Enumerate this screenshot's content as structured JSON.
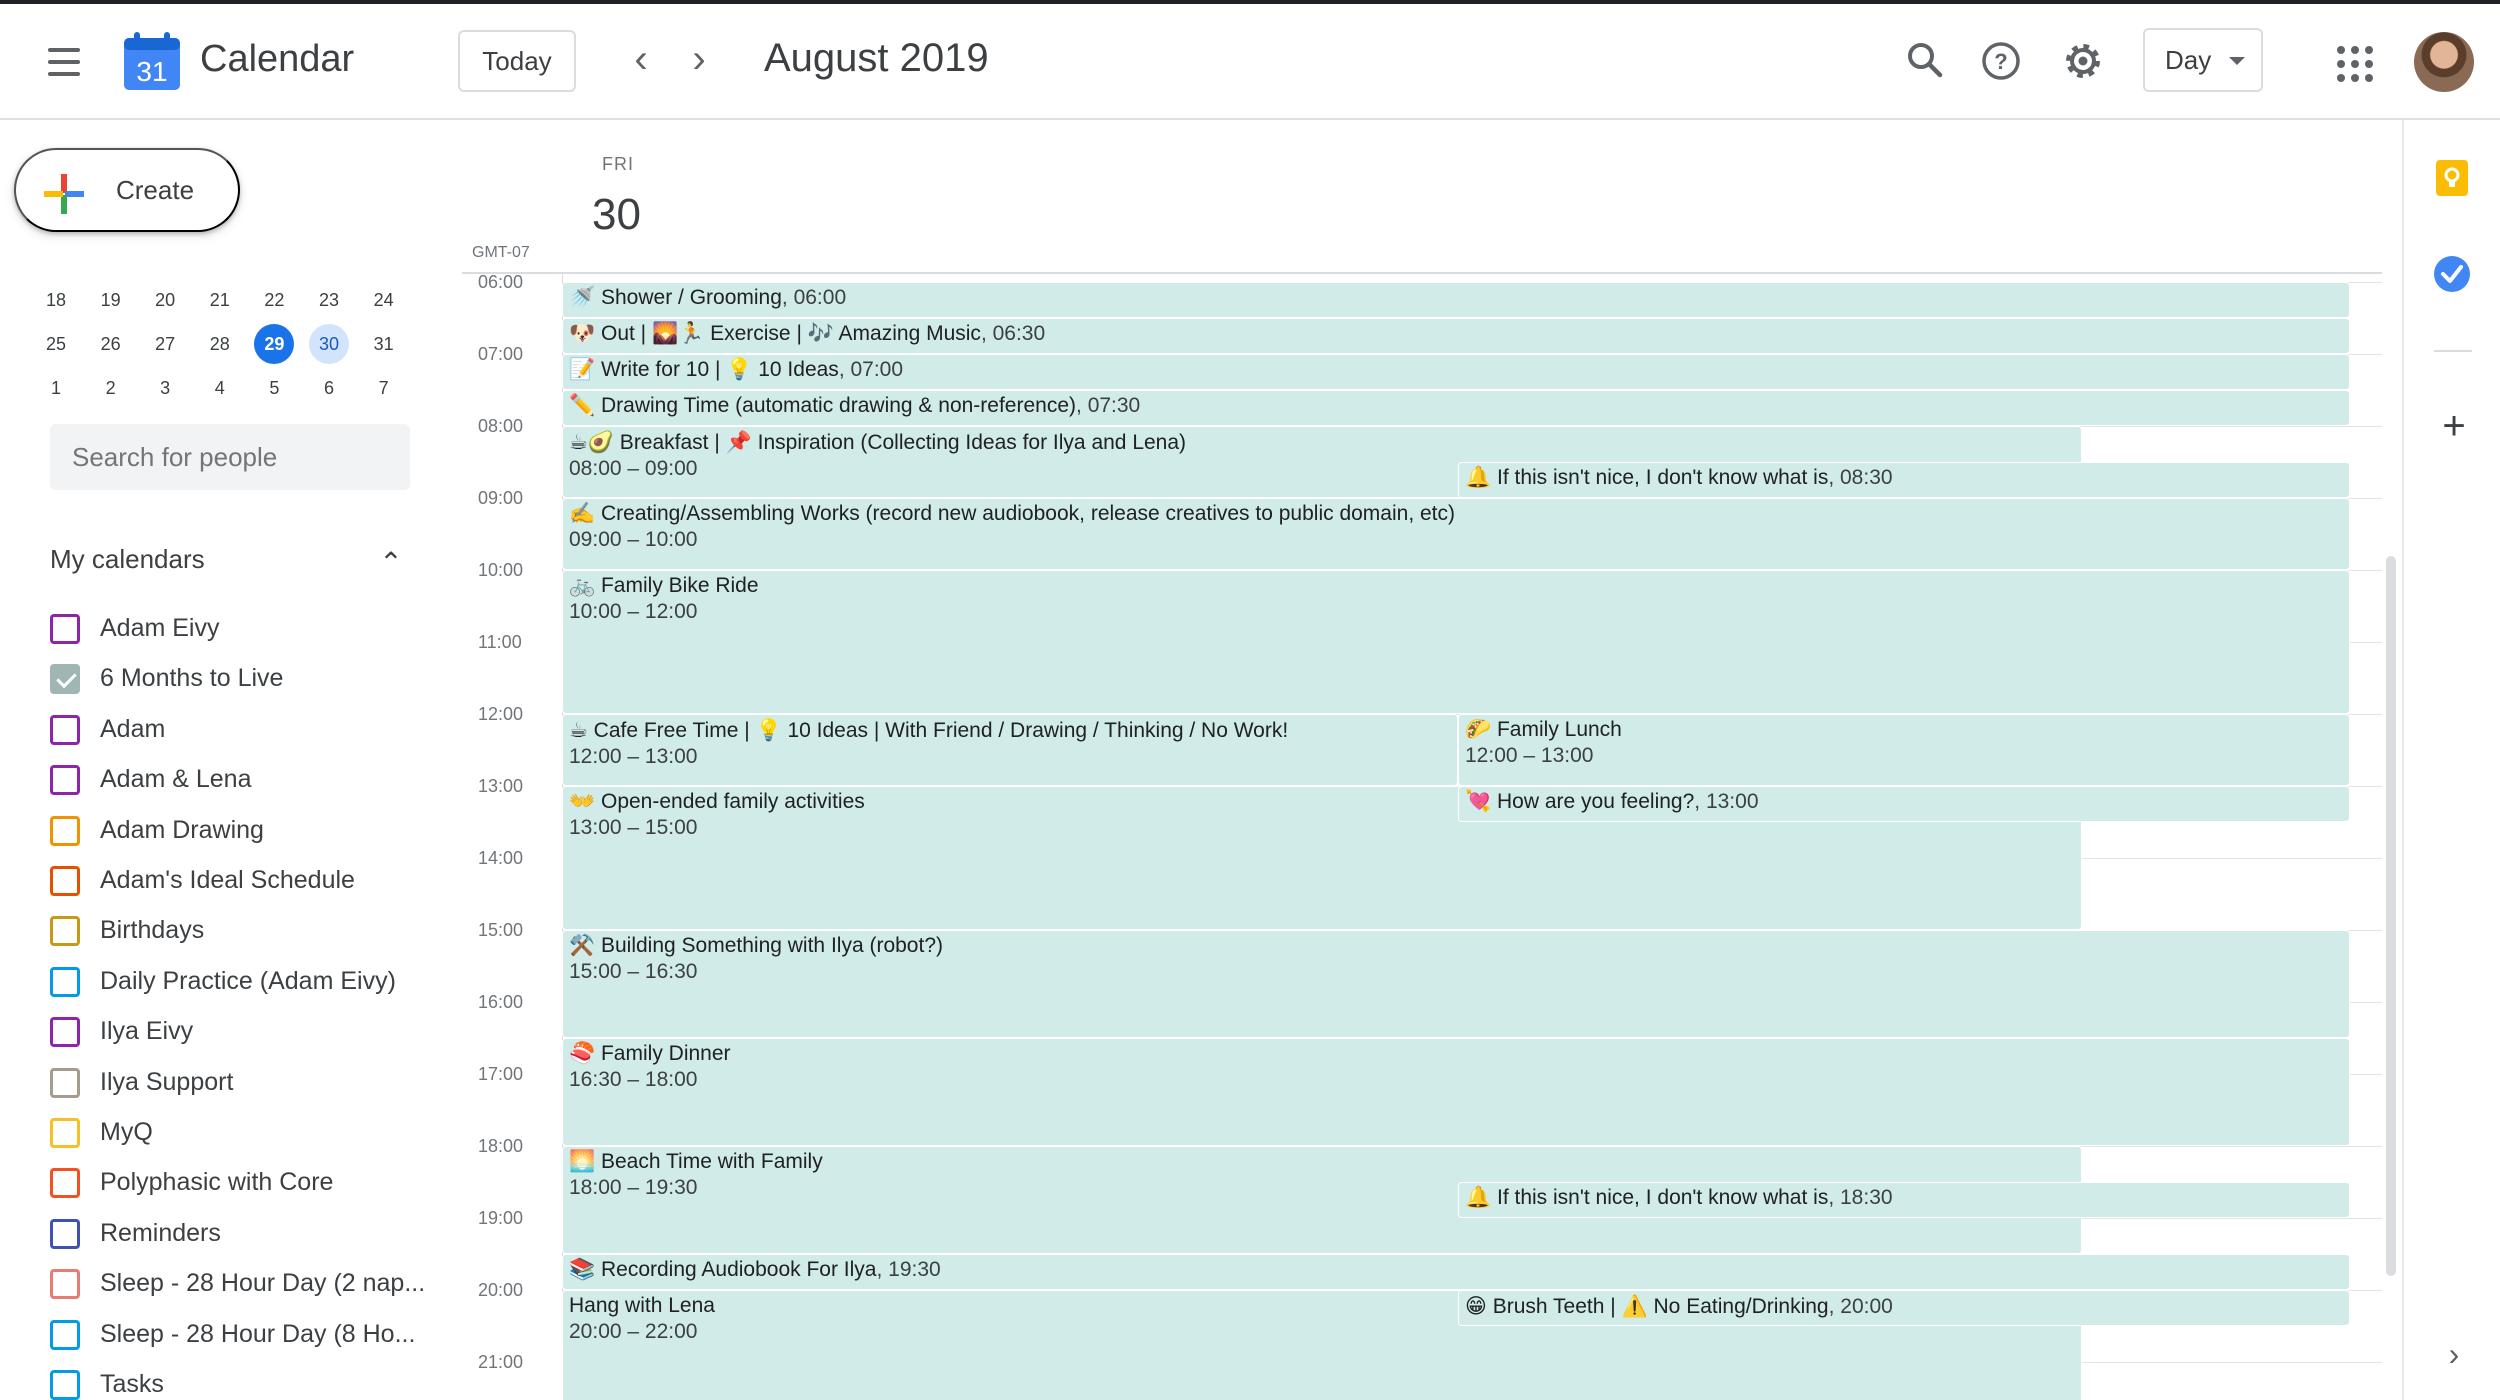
{
  "header": {
    "app_title": "Calendar",
    "logo_day": "31",
    "today_label": "Today",
    "prev_icon": "chevron-left-icon",
    "next_icon": "chevron-right-icon",
    "month_title": "August 2019",
    "view_label": "Day",
    "icons": [
      "search-icon",
      "help-icon",
      "settings-icon",
      "apps-grid-icon"
    ]
  },
  "sidebar": {
    "create_label": "Create",
    "mini_calendar": {
      "rows": [
        [
          "18",
          "19",
          "20",
          "21",
          "22",
          "23",
          "24"
        ],
        [
          "25",
          "26",
          "27",
          "28",
          "29",
          "30",
          "31"
        ],
        [
          "1",
          "2",
          "3",
          "4",
          "5",
          "6",
          "7"
        ]
      ],
      "today": "29",
      "selected": "30"
    },
    "search_people_placeholder": "Search for people",
    "my_calendars_label": "My calendars",
    "calendars": [
      {
        "name": "Adam Eivy",
        "color": "#8e24aa",
        "checked": false
      },
      {
        "name": "6 Months to Live",
        "color": "#9fb6b4",
        "checked": true
      },
      {
        "name": "Adam",
        "color": "#8e24aa",
        "checked": false
      },
      {
        "name": "Adam & Lena",
        "color": "#8e24aa",
        "checked": false
      },
      {
        "name": "Adam Drawing",
        "color": "#f09300",
        "checked": false
      },
      {
        "name": "Adam's Ideal Schedule",
        "color": "#e65100",
        "checked": false
      },
      {
        "name": "Birthdays",
        "color": "#c79a15",
        "checked": false
      },
      {
        "name": "Daily Practice (Adam Eivy)",
        "color": "#039be5",
        "checked": false
      },
      {
        "name": "Ilya Eivy",
        "color": "#8e24aa",
        "checked": false
      },
      {
        "name": "Ilya Support",
        "color": "#a79b8e",
        "checked": false
      },
      {
        "name": "MyQ",
        "color": "#f6bf26",
        "checked": false
      },
      {
        "name": "Polyphasic with Core",
        "color": "#f4511e",
        "checked": false
      },
      {
        "name": "Reminders",
        "color": "#3f51b5",
        "checked": false
      },
      {
        "name": "Sleep - 28 Hour Day (2 nap...",
        "color": "#e67c73",
        "checked": false
      },
      {
        "name": "Sleep - 28 Hour Day (8 Ho...",
        "color": "#039be5",
        "checked": false
      },
      {
        "name": "Tasks",
        "color": "#039be5",
        "checked": false
      }
    ]
  },
  "day_view": {
    "dow": "FRI",
    "date": "30",
    "timezone": "GMT-07",
    "hours": [
      "06:00",
      "07:00",
      "08:00",
      "09:00",
      "10:00",
      "11:00",
      "12:00",
      "13:00",
      "14:00",
      "15:00",
      "16:00",
      "17:00",
      "18:00",
      "19:00",
      "20:00",
      "21:00"
    ],
    "event_color": "#d0ebe8",
    "events": [
      {
        "title": "🚿 Shower / Grooming",
        "time": "06:00",
        "inline": true,
        "start": 6.0,
        "end": 6.5,
        "col": "full"
      },
      {
        "title": "🐶 Out | 🌄🏃 Exercise | 🎶 Amazing Music",
        "time": "06:30",
        "inline": true,
        "start": 6.5,
        "end": 7.0,
        "col": "full"
      },
      {
        "title": "📝 Write for 10 | 💡 10 Ideas",
        "time": "07:00",
        "inline": true,
        "start": 7.0,
        "end": 7.5,
        "col": "full"
      },
      {
        "title": "✏️ Drawing Time (automatic drawing & non-reference)",
        "time": "07:30",
        "inline": true,
        "start": 7.5,
        "end": 8.0,
        "col": "full"
      },
      {
        "title": "☕🥑 Breakfast | 📌 Inspiration (Collecting Ideas for Ilya and Lena)",
        "time": "08:00 – 09:00",
        "inline": false,
        "start": 8.0,
        "end": 9.0,
        "col": "wide"
      },
      {
        "title": "🔔 If this isn't nice, I don't know what is",
        "time": "08:30",
        "inline": true,
        "start": 8.5,
        "end": 9.0,
        "col": "right"
      },
      {
        "title": "✍️ Creating/Assembling Works (record new audiobook, release creatives to public domain, etc)",
        "time": "09:00 – 10:00",
        "inline": false,
        "start": 9.0,
        "end": 10.0,
        "col": "full"
      },
      {
        "title": "🚲 Family Bike Ride",
        "time": "10:00 – 12:00",
        "inline": false,
        "start": 10.0,
        "end": 12.0,
        "col": "full"
      },
      {
        "title": "☕ Cafe Free Time | 💡 10 Ideas | With Friend / Drawing / Thinking / No Work!",
        "time": "12:00 – 13:00",
        "inline": false,
        "start": 12.0,
        "end": 13.0,
        "col": "left"
      },
      {
        "title": "🌮 Family Lunch",
        "time": "12:00 – 13:00",
        "inline": false,
        "start": 12.0,
        "end": 13.0,
        "col": "right"
      },
      {
        "title": "👐 Open-ended family activities",
        "time": "13:00 – 15:00",
        "inline": false,
        "start": 13.0,
        "end": 15.0,
        "col": "wide"
      },
      {
        "title": "💘 How are you feeling?",
        "time": "13:00",
        "inline": true,
        "start": 13.0,
        "end": 13.5,
        "col": "right"
      },
      {
        "title": "⚒️ Building Something with Ilya (robot?)",
        "time": "15:00 – 16:30",
        "inline": false,
        "start": 15.0,
        "end": 16.5,
        "col": "full"
      },
      {
        "title": "🍣 Family Dinner",
        "time": "16:30 – 18:00",
        "inline": false,
        "start": 16.5,
        "end": 18.0,
        "col": "full"
      },
      {
        "title": "🌅 Beach Time with Family",
        "time": "18:00 – 19:30",
        "inline": false,
        "start": 18.0,
        "end": 19.5,
        "col": "wide"
      },
      {
        "title": "🔔 If this isn't nice, I don't know what is",
        "time": "18:30",
        "inline": true,
        "start": 18.5,
        "end": 19.0,
        "col": "right"
      },
      {
        "title": "📚 Recording Audiobook For Ilya",
        "time": "19:30",
        "inline": true,
        "start": 19.5,
        "end": 20.0,
        "col": "full"
      },
      {
        "title": "Hang with Lena",
        "time": "20:00 – 22:00",
        "inline": false,
        "start": 20.0,
        "end": 22.0,
        "col": "wide"
      },
      {
        "title": "😁 Brush Teeth | ⚠️ No Eating/Drinking",
        "time": "20:00",
        "inline": true,
        "start": 20.0,
        "end": 20.5,
        "col": "right"
      }
    ]
  },
  "right_panel": {
    "icons": [
      "keep-icon",
      "tasks-icon",
      "add-icon",
      "expand-chevron-icon"
    ]
  }
}
